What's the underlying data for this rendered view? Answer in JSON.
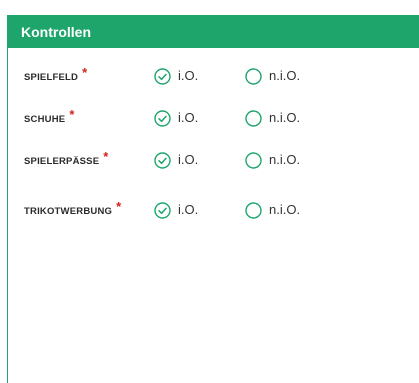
{
  "panel": {
    "title": "Kontrollen"
  },
  "colors": {
    "accent": "#1da56b",
    "required": "#d0241b"
  },
  "required_marker": "*",
  "options": {
    "ok_label": "i.O.",
    "not_ok_label": "n.i.O."
  },
  "rows": [
    {
      "label": "SPIELFELD",
      "selected": "i.O."
    },
    {
      "label": "SCHUHE",
      "selected": "i.O."
    },
    {
      "label": "SPIELERPÄSSE",
      "selected": "i.O."
    },
    {
      "label": "TRIKOTWERBUNG",
      "selected": "i.O."
    }
  ]
}
